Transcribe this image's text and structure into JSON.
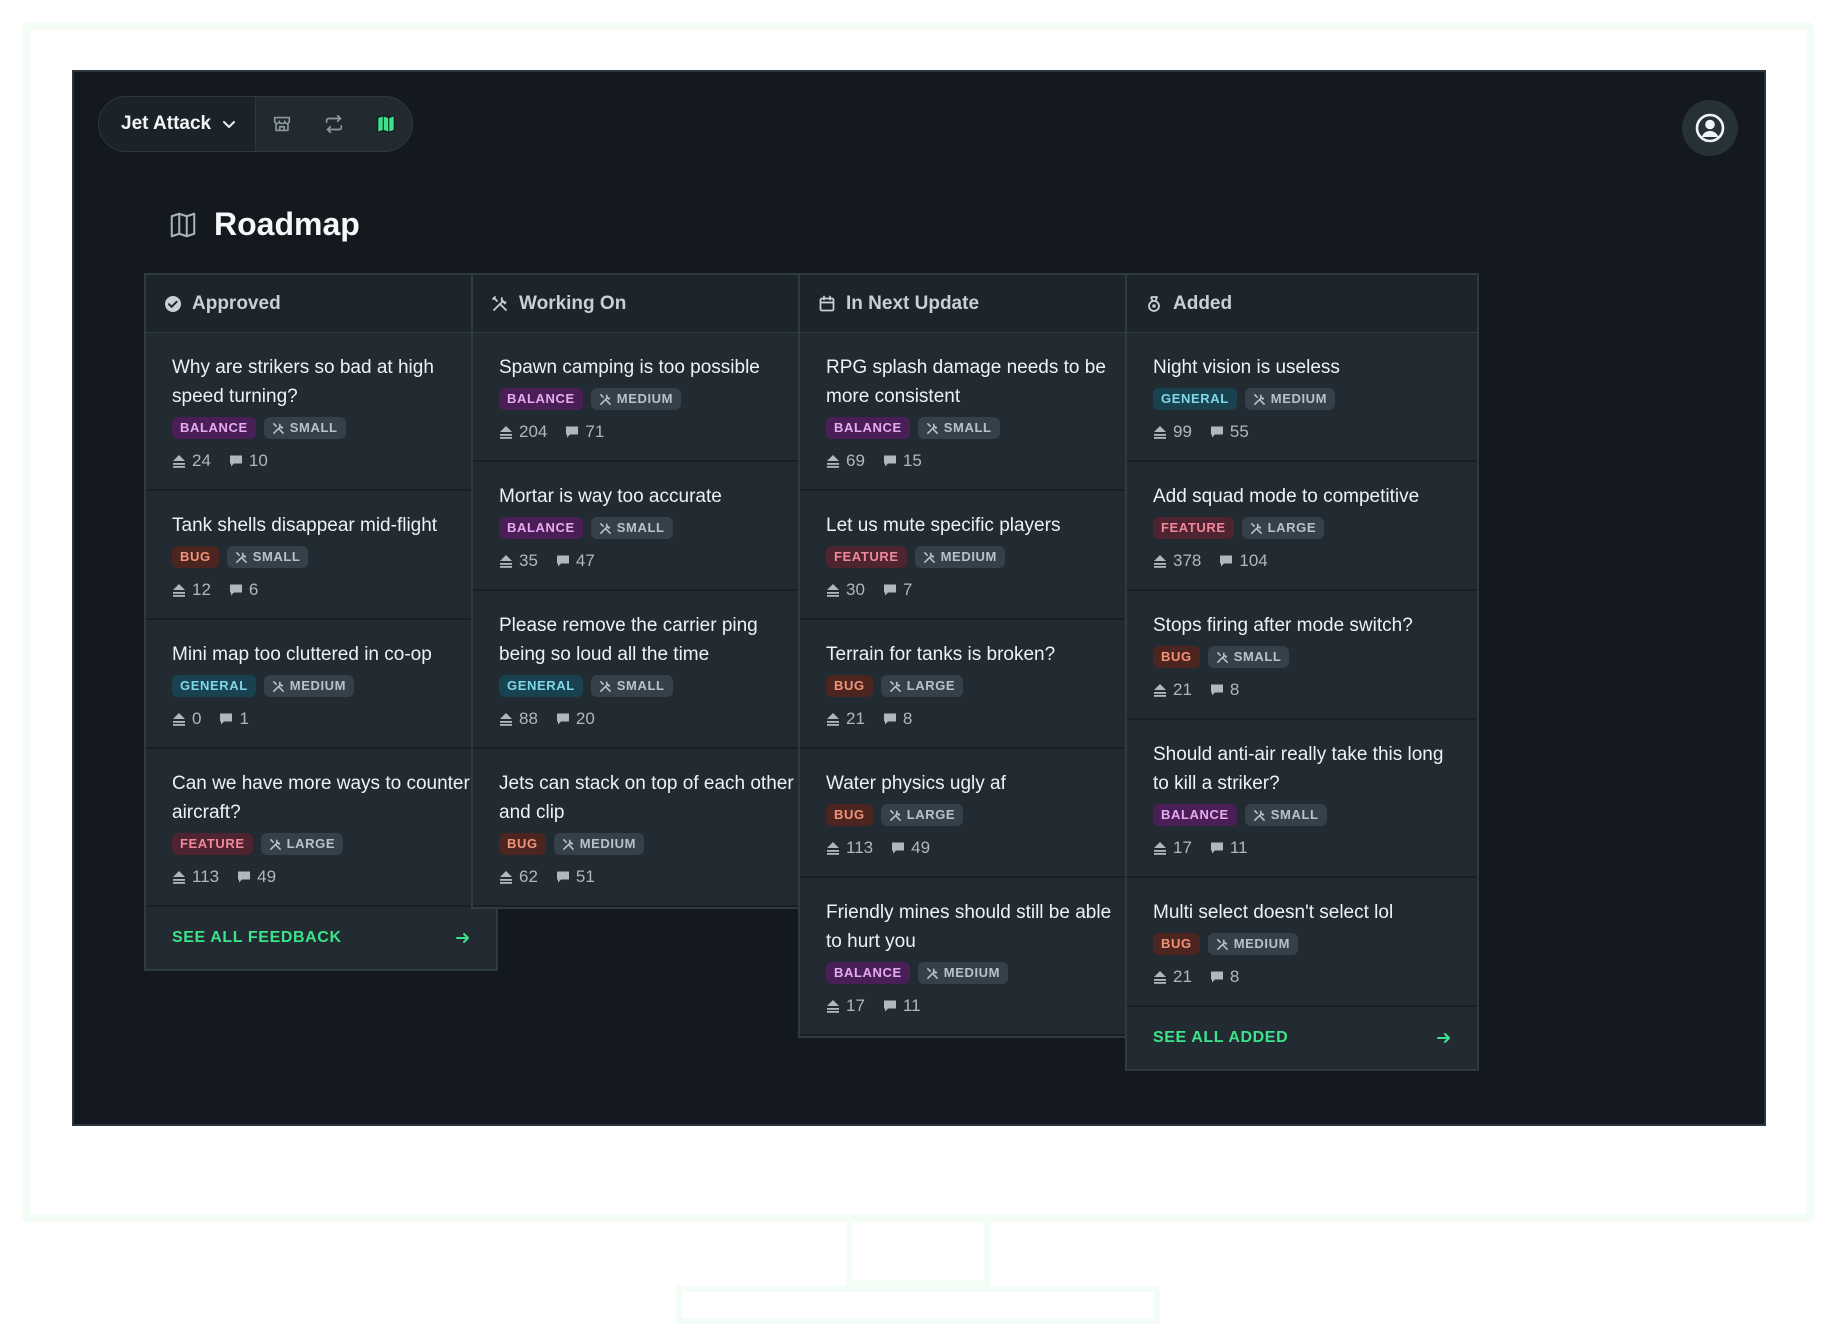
{
  "app": {
    "game_name": "Jet Attack"
  },
  "page": {
    "title": "Roadmap"
  },
  "icons": {
    "nav": [
      "store-icon",
      "swap-icon",
      "map-icon"
    ],
    "accent": "#3de38b"
  },
  "columns": [
    {
      "title": "Approved",
      "icon": "check-circle-icon",
      "footer": "SEE ALL FEEDBACK",
      "cards": [
        {
          "title": "Why are strikers so bad at high speed turning?",
          "category": "BALANCE",
          "size": "SMALL",
          "votes": "24",
          "comments": "10"
        },
        {
          "title": "Tank shells disappear mid-flight",
          "category": "BUG",
          "size": "SMALL",
          "votes": "12",
          "comments": "6"
        },
        {
          "title": "Mini map too cluttered in co-op",
          "category": "GENERAL",
          "size": "MEDIUM",
          "votes": "0",
          "comments": "1"
        },
        {
          "title": "Can we have more ways to counter aircraft?",
          "category": "FEATURE",
          "size": "LARGE",
          "votes": "113",
          "comments": "49"
        }
      ]
    },
    {
      "title": "Working On",
      "icon": "tools-icon",
      "footer": "",
      "cards": [
        {
          "title": "Spawn camping is too possible",
          "category": "BALANCE",
          "size": "MEDIUM",
          "votes": "204",
          "comments": "71"
        },
        {
          "title": "Mortar is way too accurate",
          "category": "BALANCE",
          "size": "SMALL",
          "votes": "35",
          "comments": "47"
        },
        {
          "title": "Please remove the carrier ping being so loud all the time",
          "category": "GENERAL",
          "size": "SMALL",
          "votes": "88",
          "comments": "20"
        },
        {
          "title": "Jets can stack on top of each other and clip",
          "category": "BUG",
          "size": "MEDIUM",
          "votes": "62",
          "comments": "51"
        }
      ]
    },
    {
      "title": "In Next Update",
      "icon": "calendar-icon",
      "footer": "",
      "cards": [
        {
          "title": "RPG splash damage needs to be more consistent",
          "category": "BALANCE",
          "size": "SMALL",
          "votes": "69",
          "comments": "15"
        },
        {
          "title": "Let us mute specific players",
          "category": "FEATURE",
          "size": "MEDIUM",
          "votes": "30",
          "comments": "7"
        },
        {
          "title": "Terrain for tanks is broken?",
          "category": "BUG",
          "size": "LARGE",
          "votes": "21",
          "comments": "8"
        },
        {
          "title": "Water physics ugly af",
          "category": "BUG",
          "size": "LARGE",
          "votes": "113",
          "comments": "49"
        },
        {
          "title": "Friendly mines should still be able to hurt you",
          "category": "BALANCE",
          "size": "MEDIUM",
          "votes": "17",
          "comments": "11"
        }
      ]
    },
    {
      "title": "Added",
      "icon": "medal-icon",
      "footer": "SEE ALL ADDED",
      "cards": [
        {
          "title": "Night vision is useless",
          "category": "GENERAL",
          "size": "MEDIUM",
          "votes": "99",
          "comments": "55"
        },
        {
          "title": "Add squad mode to competitive",
          "category": "FEATURE",
          "size": "LARGE",
          "votes": "378",
          "comments": "104"
        },
        {
          "title": "Stops firing after mode switch?",
          "category": "BUG",
          "size": "SMALL",
          "votes": "21",
          "comments": "8"
        },
        {
          "title": "Should anti-air really take this long to kill a striker?",
          "category": "BALANCE",
          "size": "SMALL",
          "votes": "17",
          "comments": "11"
        },
        {
          "title": "Multi select doesn't select lol",
          "category": "BUG",
          "size": "MEDIUM",
          "votes": "21",
          "comments": "8"
        }
      ]
    }
  ]
}
